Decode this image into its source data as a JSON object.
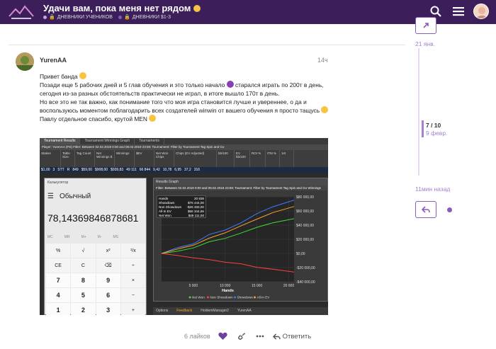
{
  "header": {
    "title": "Удачи вам, пока меня нет рядом",
    "categories": [
      {
        "label": "ДНЕВНИКИ УЧЕНИКОВ",
        "color": "#c6a2e6"
      },
      {
        "label": "ДНЕВНИКИ $1-3",
        "color": "#7c5ac0"
      }
    ],
    "icons": [
      "search-icon",
      "hamburger-icon",
      "user-avatar"
    ]
  },
  "post": {
    "author": "YurenAA",
    "date": "14ч",
    "paragraphs": [
      "Привет банда",
      "Позади еще 5 рабочих дней и 5 глав обучения и это только начало",
      "старался играть по 200т в день, сегодня из-за разных обстоятельств практически не играл, в итоге вышло 170т в день.",
      "Но все это не так важно, как понимание того что моя игра становится лучше и увереннее, о да и воспользуюсь моментом поблагодарить всех создателей winwin от вашего обучения я просто тащусь",
      "Павлу отдельное спасибо, крутой MEN"
    ],
    "likes": "6 лайков",
    "reply_label": "Ответить"
  },
  "screenshot": {
    "tabs": [
      "Tournament Results",
      "Tournament Winnings Graph",
      "Tournaments"
    ],
    "filter_text": "Player: YurenAA (PS)   Filter: Between 02.02.2018 0:00 and 08.02.2018 23:59; Tournament: Filter by Tournament Tag  Spin and Go",
    "columns": [
      "Stakes",
      "Table Size",
      "Tag Count",
      "Net Winnings $",
      "Winnings",
      "$EV",
      "Net Won Chips",
      "Chips (EV Adjusted)",
      "bb/100",
      "EV bb/100",
      "ROI %",
      "ITM %",
      "1st"
    ],
    "row": [
      "$1,00",
      "3",
      "STT",
      "R",
      "849",
      "$59,00",
      "$908,00",
      "$939,83",
      "49 111",
      "66 844",
      "9,42",
      "10,78",
      "6,95",
      "37,2",
      "316"
    ],
    "calculator": {
      "title": "Калькулятор",
      "mode": "Обычный",
      "display": "78,14369846878681",
      "memory": [
        "MC",
        "MR",
        "M+",
        "M-",
        "MS",
        "M˅"
      ],
      "keys": [
        "%",
        "√",
        "x²",
        "¹/x",
        "CE",
        "C",
        "⌫",
        "÷",
        "7",
        "8",
        "9",
        "×",
        "4",
        "5",
        "6",
        "−",
        "1",
        "2",
        "3",
        "+"
      ]
    },
    "graph": {
      "title": "Results Graph",
      "filter_text": "Filter: Between 02.02.2018 0:00 and 08.02.2018 23:59; Tournament: Filter by Tournament Tag  Spin and Go  Winnings",
      "stats": [
        {
          "label": "Hands",
          "value": "20 838"
        },
        {
          "label": "Showdown",
          "value": "$75 444,00"
        },
        {
          "label": "Non Showdown",
          "value": "-$26 333,00"
        },
        {
          "label": "All-In EV",
          "value": "$66 344,65"
        },
        {
          "label": "Net Won",
          "value": "$49 111,00"
        }
      ],
      "legend": [
        "Net Won",
        "Non Showdown",
        "Showdown",
        "All-In EV"
      ],
      "bottom_items": [
        "Options",
        "Feedback",
        "HoldemManager2",
        "YurenAA"
      ]
    },
    "chart_data": {
      "type": "line",
      "xlabel": "Hands",
      "x_ticks": [
        "5 000",
        "10 000",
        "15 000",
        "20 000"
      ],
      "y_ticks": [
        "$80 000,00",
        "$60 000,00",
        "$40 000,00",
        "$20 000,00",
        "$0,00",
        "-$20 000,00",
        "-$40 000,00"
      ],
      "x": [
        0,
        2500,
        5000,
        7500,
        10000,
        12500,
        15000,
        17500,
        20838
      ],
      "series": [
        {
          "name": "Net Won",
          "color": "#3ddc36",
          "values": [
            0,
            3000,
            8000,
            16000,
            22000,
            28000,
            38000,
            42000,
            49111
          ]
        },
        {
          "name": "Non Showdown",
          "color": "#ff4040",
          "values": [
            0,
            -3000,
            -6000,
            -9000,
            -12000,
            -15000,
            -19000,
            -23000,
            -26333
          ]
        },
        {
          "name": "Showdown",
          "color": "#3c7bff",
          "values": [
            0,
            8000,
            14000,
            26000,
            34000,
            42000,
            58000,
            64000,
            75444
          ]
        },
        {
          "name": "All-In EV",
          "color": "#ff9e2e",
          "values": [
            0,
            6000,
            12000,
            21000,
            30000,
            38000,
            50000,
            56000,
            66344
          ]
        }
      ],
      "ylim": [
        -40000,
        80000
      ],
      "xlim": [
        0,
        20838
      ]
    }
  },
  "timeline": {
    "top_date": "21 янв.",
    "position": "7 / 10",
    "position_date": "9 февр.",
    "last": "11мин назад"
  }
}
